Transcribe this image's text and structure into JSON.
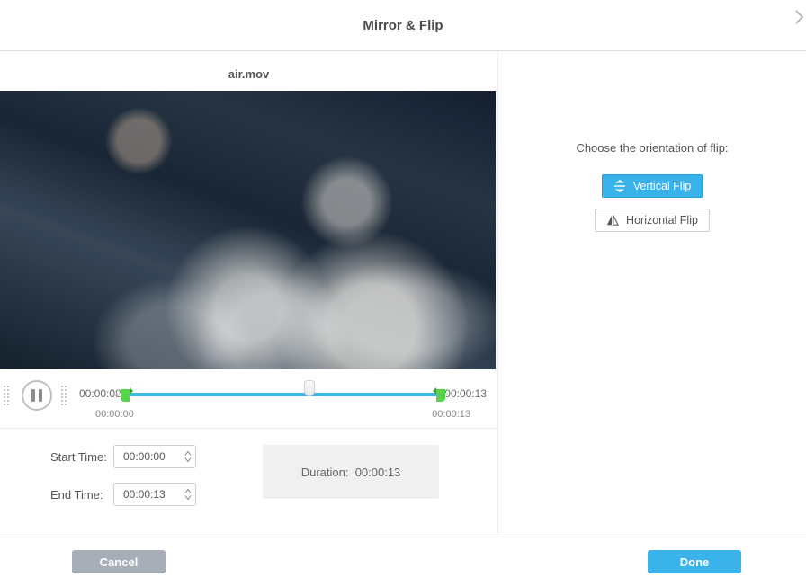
{
  "title": "Mirror & Flip",
  "file_name": "air.mov",
  "timeline": {
    "current": "00:00:08",
    "total": "00:00:13",
    "range_start": "00:00:00",
    "range_end": "00:00:13"
  },
  "controls": {
    "start_label": "Start Time:",
    "end_label": "End Time:",
    "start_value": "00:00:00",
    "end_value": "00:00:13",
    "duration_label": "Duration:",
    "duration_value": "00:00:13"
  },
  "right": {
    "prompt": "Choose the orientation of flip:",
    "vertical_label": "Vertical Flip",
    "horizontal_label": "Horizontal Flip"
  },
  "footer": {
    "cancel": "Cancel",
    "done": "Done"
  }
}
